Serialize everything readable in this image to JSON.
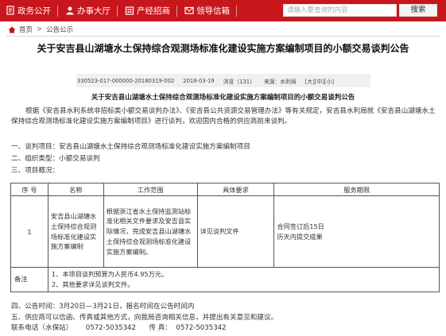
{
  "nav": {
    "items": [
      {
        "label": "政务公开",
        "icon": "document-icon"
      },
      {
        "label": "办事大厅",
        "icon": "user-icon"
      },
      {
        "label": "产经招商",
        "icon": "building-icon"
      },
      {
        "label": "领导信箱",
        "icon": "envelope-icon"
      }
    ],
    "search_placeholder": "请输入要查询的内容",
    "search_button": "搜索",
    "colors": {
      "bar": "#c8161d",
      "text": "#ffffff"
    }
  },
  "breadcrumb": {
    "home": "首页",
    "separator": ">",
    "section": "公告公示"
  },
  "article": {
    "title": "关于安吉县山湖塘水土保持综合观测场标准化建设实施方案编制项目的小额交易谈判公告",
    "meta": {
      "doc_no": "330523-017-000000-20180319-002",
      "date": "2018-03-19",
      "views_label": "浏览（131）",
      "source_label": "来源：水利局",
      "font_size_label": "[大][中][小]"
    },
    "subtitle": "关于安吉县山湖塘水土保持综合观测场标准化建设实施方案编制项目的小额交易谈判公告",
    "intro": "根据《安吉县水利系统非招标类小额交易谈判办法》、《安吉县公共资源交易管理办法》等有关规定，安吉县水利局就《安吉县山湖塘水土保持综合观测场标准化建设实施方案编制项目》进行谈判，欢迎国内合格的供应商前来谈判。",
    "item1": "一、谈判项目：安吉县山湖塘水土保持综合观测场标准化建设实施方案编制项目",
    "item2": "二、组织类型：小额交易谈判",
    "item3": "三、项目概况：",
    "table": {
      "headers": [
        "序 号",
        "名称",
        "工作范围",
        "具体要求",
        "服务期限"
      ],
      "row": {
        "no": "1",
        "name": "安吉县山湖塘水土保持综合观测场标准化建设实施方案编制",
        "scope": "根据浙江省水土保持监测站标准化相关文件要求及安吉县实际情况，完成安吉县山湖塘水土保持综合观测场标准化建设实施方案编制。",
        "requirement": "详见谈判文件",
        "period": "合同签订后15日历天内提交成果"
      },
      "note_label": "备注",
      "note_lines": [
        "1、本项目谈判预算为人民币4.95万元。",
        "2、其他要求详见谈判文件。"
      ]
    },
    "item4": "四、公告时间：3月20日—3月21日，报名时间在公告时间内",
    "item5": "五、供应商可以信函、传真或其他方式，向我局咨询相关信息，并提出有关意见和建议。",
    "contact": "联系电话（水保站）      0572-5035342      传 真：  0572-5035342"
  }
}
